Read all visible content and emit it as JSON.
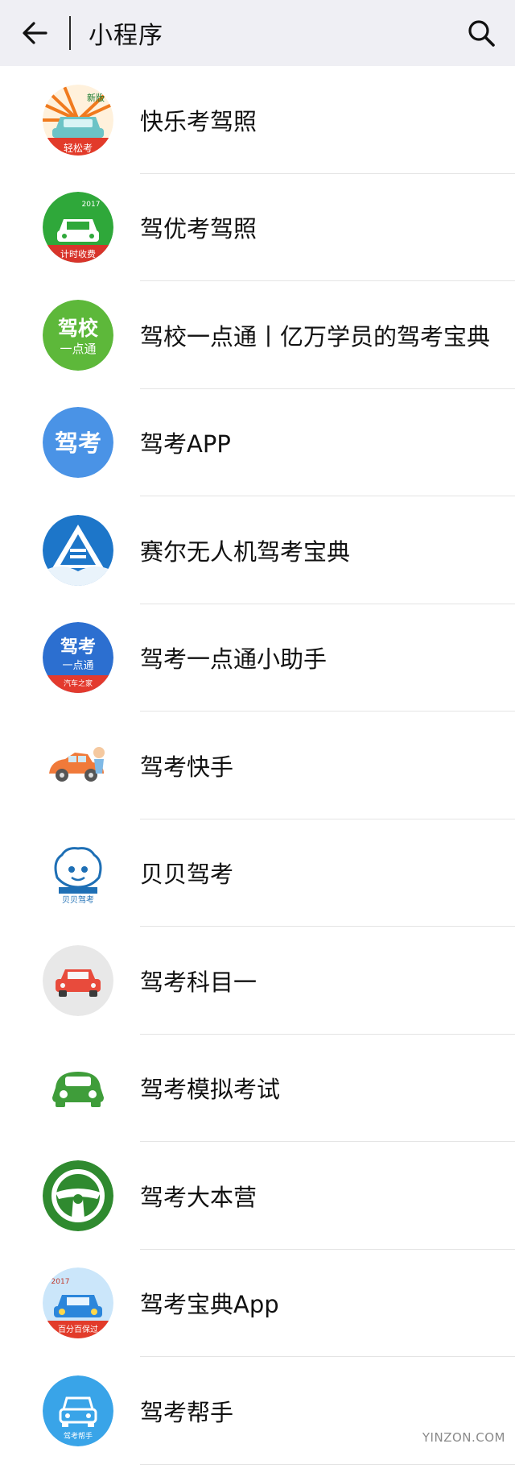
{
  "header": {
    "title": "小程序",
    "background": "#efeff4",
    "back_icon": "arrow-left-icon",
    "search_icon": "search-icon"
  },
  "items": [
    {
      "label": "快乐考驾照",
      "icon": "car-sun-badge-icon",
      "badge_top": "新版",
      "badge_bottom": "轻松考"
    },
    {
      "label": "驾优考驾照",
      "icon": "green-car-badge-icon",
      "badge_top": "2017",
      "badge_bottom": "计时收费"
    },
    {
      "label": "驾校一点通丨亿万学员的驾考宝典",
      "icon": "jiaxiao-text-icon",
      "badge_top": "驾校",
      "badge_bottom": "一点通"
    },
    {
      "label": "驾考APP",
      "icon": "jiakao-text-icon",
      "badge_top": "驾考"
    },
    {
      "label": "赛尔无人机驾考宝典",
      "icon": "drone-triangle-icon"
    },
    {
      "label": "驾考一点通小助手",
      "icon": "jiakao-yidiantong-icon",
      "badge_top": "驾考",
      "badge_mid": "一点通",
      "badge_bottom": "汽车之家"
    },
    {
      "label": "驾考快手",
      "icon": "cartoon-car-icon"
    },
    {
      "label": "贝贝驾考",
      "icon": "shell-mascot-icon",
      "badge_bottom": "贝贝驾考"
    },
    {
      "label": "驾考科目一",
      "icon": "red-car-icon"
    },
    {
      "label": "驾考模拟考试",
      "icon": "green-car-icon"
    },
    {
      "label": "驾考大本营",
      "icon": "steering-wheel-icon"
    },
    {
      "label": "驾考宝典App",
      "icon": "blue-car-badge-icon",
      "badge_top": "2017",
      "badge_bottom": "百分百保过"
    },
    {
      "label": "驾考帮手",
      "icon": "car-outline-icon",
      "badge_bottom": "驾考帮手"
    }
  ],
  "watermark": "YINZON.COM",
  "colors": {
    "green": "#3fae2a",
    "blue": "#3d8fe0",
    "orange": "#f07a1e",
    "red": "#e84b3c"
  }
}
